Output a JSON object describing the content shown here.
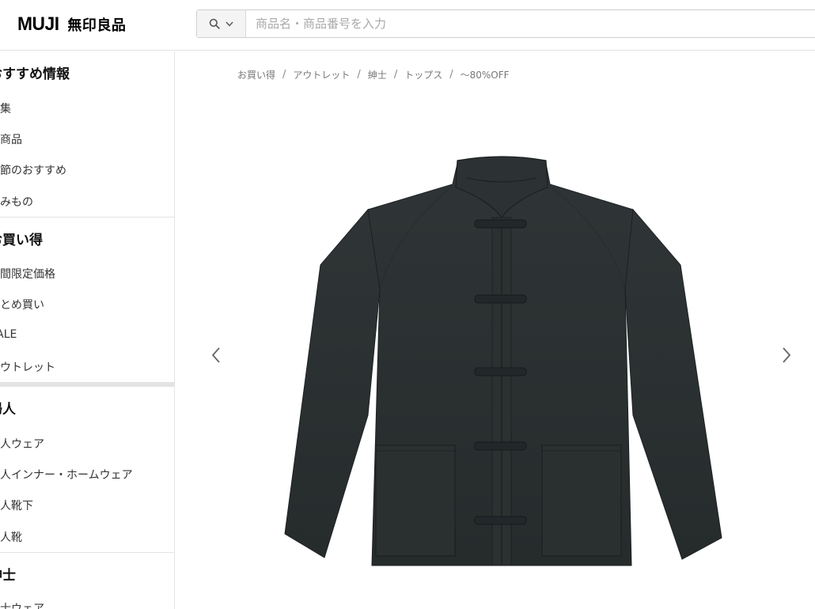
{
  "header": {
    "logo_en": "MUJI",
    "logo_jp": "無印良品",
    "search_placeholder": "商品名・商品番号を入力",
    "search_scope_icon": "search-icon"
  },
  "sidebar": {
    "sections": [
      {
        "heading": "おすすめ情報",
        "items": [
          "特集",
          "新商品",
          "季節のおすすめ",
          "読みもの"
        ]
      },
      {
        "heading": "お買い得",
        "items": [
          "期間限定価格",
          "まとめ買い",
          "SALE",
          "アウトレット"
        ]
      },
      {
        "heading": "婦人",
        "items": [
          "婦人ウェア",
          "婦人インナー・ホームウェア",
          "婦人靴下",
          "婦人靴"
        ]
      },
      {
        "heading": "紳士",
        "items": [
          "紳士ウェア"
        ]
      }
    ]
  },
  "breadcrumb": [
    "お買い得",
    "アウトレット",
    "紳士",
    "トップス",
    "～80%OFF"
  ],
  "carousel": {
    "prev_icon": "chevron-left-icon",
    "next_icon": "chevron-right-icon",
    "product_color": "#2a2f30"
  }
}
